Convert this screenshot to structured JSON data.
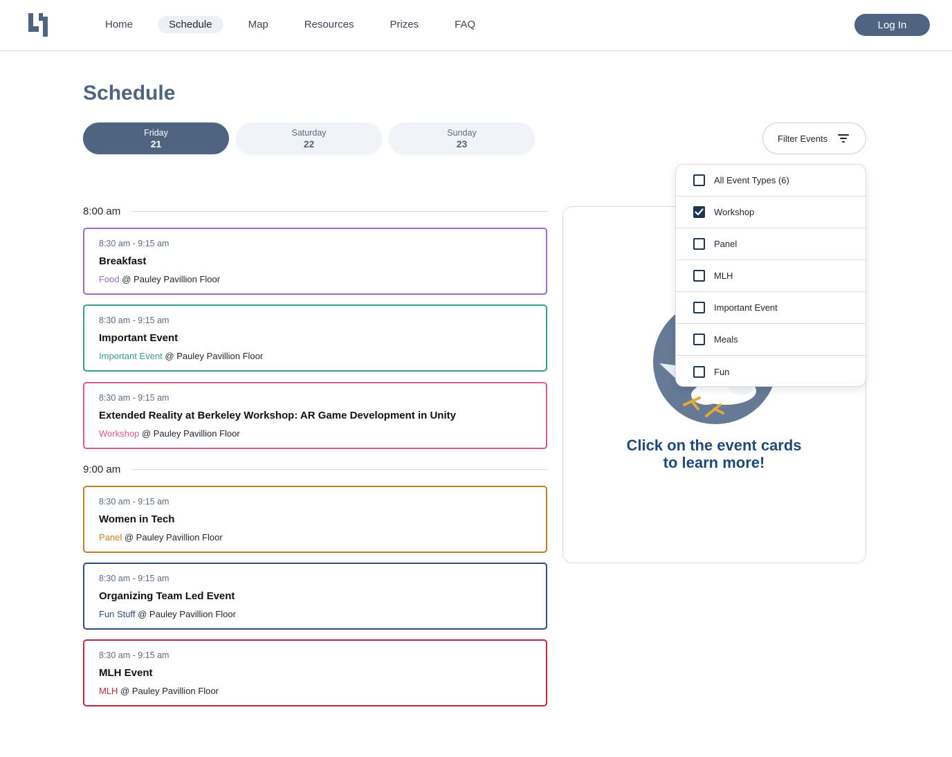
{
  "nav": {
    "items": [
      {
        "label": "Home",
        "active": false
      },
      {
        "label": "Schedule",
        "active": true
      },
      {
        "label": "Map",
        "active": false
      },
      {
        "label": "Resources",
        "active": false
      },
      {
        "label": "Prizes",
        "active": false
      },
      {
        "label": "FAQ",
        "active": false
      }
    ],
    "login_label": "Log In"
  },
  "page": {
    "title": "Schedule"
  },
  "days": [
    {
      "name": "Friday",
      "num": "21",
      "active": true
    },
    {
      "name": "Saturday",
      "num": "22",
      "active": false
    },
    {
      "name": "Sunday",
      "num": "23",
      "active": false
    }
  ],
  "filter": {
    "label": "Filter Events",
    "options": [
      {
        "label": "All Event Types (6)",
        "checked": false
      },
      {
        "label": "Workshop",
        "checked": true
      },
      {
        "label": "Panel",
        "checked": false
      },
      {
        "label": "MLH",
        "checked": false
      },
      {
        "label": "Important Event",
        "checked": false
      },
      {
        "label": "Meals",
        "checked": false
      },
      {
        "label": "Fun",
        "checked": false
      }
    ]
  },
  "times": [
    "8:00 am",
    "9:00 am"
  ],
  "events": [
    {
      "time": "8:30 am - 9:15 am",
      "title": "Breakfast",
      "category": "Food",
      "location": " @ Pauley Pavillion Floor",
      "color": "#9b6bc9"
    },
    {
      "time": "8:30 am - 9:15 am",
      "title": "Important Event",
      "category": "Important Event",
      "location": " @ Pauley Pavillion Floor",
      "color": "#3a9a8c"
    },
    {
      "time": "8:30 am - 9:15 am",
      "title": "Extended Reality at Berkeley Workshop: AR Game Development in Unity",
      "category": "Workshop",
      "location": " @ Pauley Pavillion Floor",
      "color": "#d9588f"
    },
    {
      "time": "8:30 am - 9:15 am",
      "title": "Women in Tech",
      "category": "Panel",
      "location": " @ Pauley Pavillion Floor",
      "color": "#c47f1d"
    },
    {
      "time": "8:30 am - 9:15 am",
      "title": "Organizing Team Led Event",
      "category": "Fun Stuff",
      "location": " @ Pauley Pavillion Floor",
      "color": "#2e4a8a"
    },
    {
      "time": "8:30 am - 9:15 am",
      "title": "MLH Event",
      "category": "MLH",
      "location": " @ Pauley Pavillion Floor",
      "color": "#b8263f"
    }
  ],
  "info": {
    "line1": "Click on the event cards",
    "line2": "to learn more!"
  },
  "colors": {
    "brand": "#4f6481",
    "info_text": "#1f4a78",
    "checkbox": "#1f3550"
  }
}
